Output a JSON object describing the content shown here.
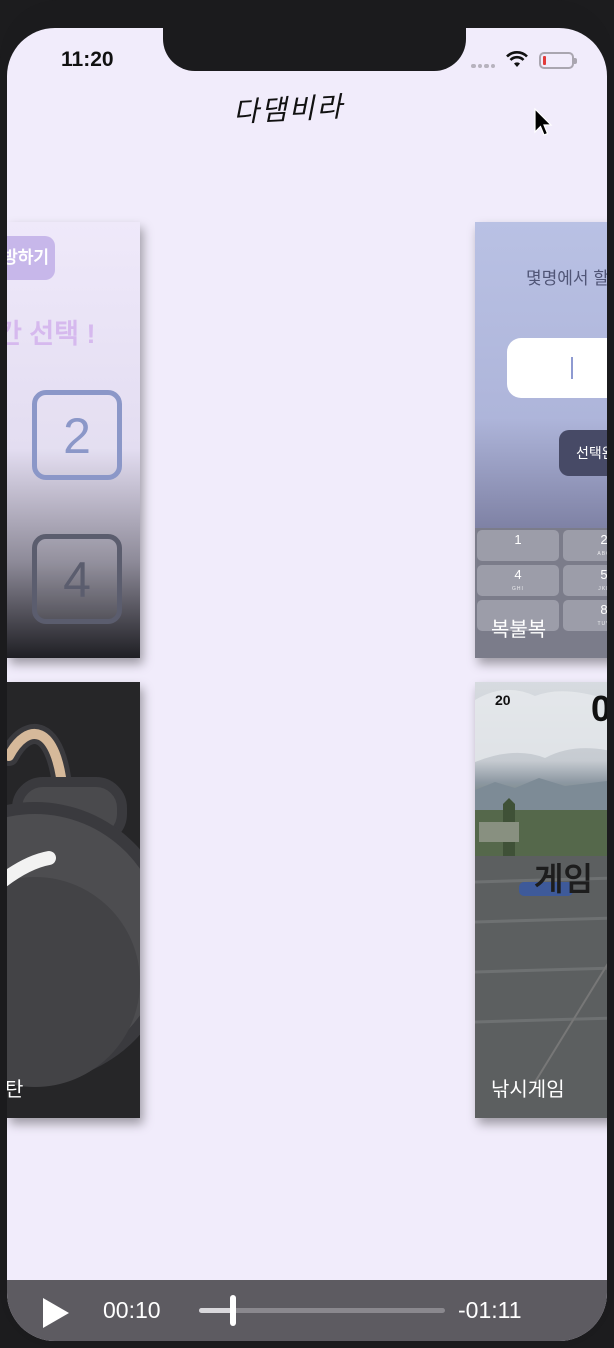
{
  "status_bar": {
    "time": "11:20",
    "wifi_icon": "wifi-icon",
    "battery_icon": "battery-low-icon",
    "battery_color": "#e23b3b"
  },
  "app": {
    "logo": "다댐비라"
  },
  "cards": [
    {
      "label": "",
      "button_label": "방하기",
      "heading": "칸 선택 !",
      "numbers": [
        "2",
        "4"
      ]
    },
    {
      "label": "복불복",
      "prompt": "몇명에서 할",
      "confirm_label": "선택완",
      "keys": [
        {
          "digit": "1",
          "letters": ""
        },
        {
          "digit": "2",
          "letters": "ABC"
        },
        {
          "digit": "4",
          "letters": "GHI"
        },
        {
          "digit": "5",
          "letters": "JKL"
        },
        {
          "digit": "",
          "letters": ""
        },
        {
          "digit": "8",
          "letters": "TUV"
        }
      ]
    },
    {
      "label": "탄",
      "image_icon": "bomb-icon"
    },
    {
      "label": "낚시게임",
      "score": "20",
      "timer": "0",
      "overlay_text": "게임"
    }
  ],
  "player": {
    "elapsed": "00:10",
    "remaining": "-01:11",
    "progress": 0.14
  },
  "colors": {
    "background": "#f1ecfb",
    "accent": "#c7b7ea"
  }
}
